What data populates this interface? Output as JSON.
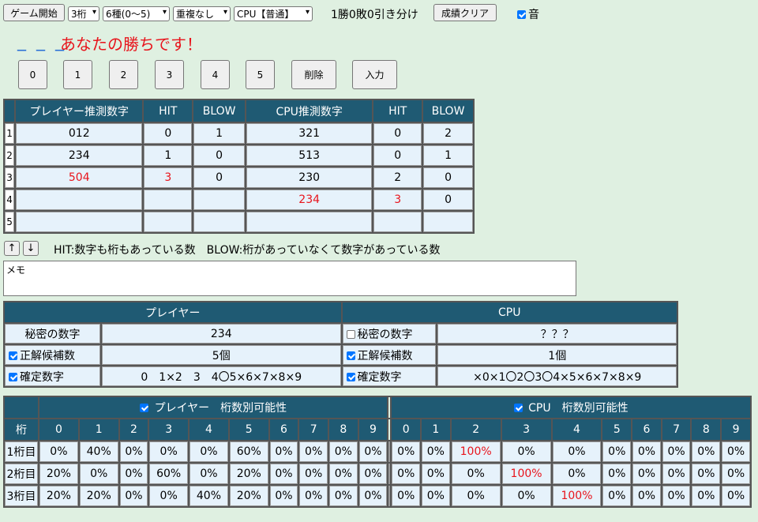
{
  "toolbar": {
    "start_label": "ゲーム開始",
    "digits_select": "3桁",
    "kinds_select": "6種(0〜5)",
    "dup_select": "重複なし",
    "cpu_select": "CPU【普通】",
    "record_text": "1勝0敗0引き分け",
    "clear_label": "成績クリア",
    "sound_label": "音"
  },
  "status": {
    "input_dashes": "_ _ _",
    "message": "あなたの勝ちです！"
  },
  "keypad": {
    "digits": [
      "0",
      "1",
      "2",
      "3",
      "4",
      "5"
    ],
    "delete_label": "削除",
    "enter_label": "入力"
  },
  "history": {
    "headers": [
      "プレイヤー推測数字",
      "HIT",
      "BLOW",
      "CPU推測数字",
      "HIT",
      "BLOW"
    ],
    "rows": [
      {
        "idx": "1",
        "p": "012",
        "ph": "0",
        "pb": "1",
        "c": "321",
        "ch": "0",
        "cb": "2"
      },
      {
        "idx": "2",
        "p": "234",
        "ph": "1",
        "pb": "0",
        "c": "513",
        "ch": "0",
        "cb": "1"
      },
      {
        "idx": "3",
        "p": "504",
        "ph": "3",
        "pb": "0",
        "c": "230",
        "ch": "2",
        "cb": "0"
      },
      {
        "idx": "4",
        "p": "",
        "ph": "",
        "pb": "",
        "c": "234",
        "ch": "3",
        "cb": "0"
      },
      {
        "idx": "5",
        "p": "",
        "ph": "",
        "pb": "",
        "c": "",
        "ch": "",
        "cb": ""
      }
    ]
  },
  "scroll": {
    "up": "↑",
    "down": "↓"
  },
  "legend_text": "HIT:数字も桁もあっている数　BLOW:桁があっていなくて数字があっている数",
  "memo_placeholder": "メモ",
  "info": {
    "player_header": "プレイヤー",
    "cpu_header": "CPU",
    "secret_label": "秘密の数字",
    "candidates_label": "正解候補数",
    "confirmed_label": "確定数字",
    "player_secret": "234",
    "player_candidates": "5個",
    "player_confirmed": "0　1×2　3　4〇5×6×7×8×9",
    "cpu_secret": "？？？",
    "cpu_candidates": "1個",
    "cpu_confirmed": "×0×1〇2〇3〇4×5×6×7×8×9"
  },
  "prob": {
    "player_title": "プレイヤー　桁数別可能性",
    "cpu_title": "CPU　桁数別可能性",
    "row_header": "桁",
    "digits": [
      "0",
      "1",
      "2",
      "3",
      "4",
      "5",
      "6",
      "7",
      "8",
      "9"
    ],
    "row_labels": [
      "1桁目",
      "2桁目",
      "3桁目"
    ],
    "player": [
      [
        "0%",
        "40%",
        "0%",
        "0%",
        "0%",
        "60%",
        "0%",
        "0%",
        "0%",
        "0%"
      ],
      [
        "20%",
        "0%",
        "0%",
        "60%",
        "0%",
        "20%",
        "0%",
        "0%",
        "0%",
        "0%"
      ],
      [
        "20%",
        "20%",
        "0%",
        "0%",
        "40%",
        "20%",
        "0%",
        "0%",
        "0%",
        "0%"
      ]
    ],
    "cpu": [
      [
        "0%",
        "0%",
        "100%",
        "0%",
        "0%",
        "0%",
        "0%",
        "0%",
        "0%",
        "0%"
      ],
      [
        "0%",
        "0%",
        "0%",
        "100%",
        "0%",
        "0%",
        "0%",
        "0%",
        "0%",
        "0%"
      ],
      [
        "0%",
        "0%",
        "0%",
        "0%",
        "100%",
        "0%",
        "0%",
        "0%",
        "0%",
        "0%"
      ]
    ]
  },
  "colors": {
    "header_bg": "#1f5a73",
    "highlight": "#e8141c",
    "page_bg": "#dff0e1"
  }
}
